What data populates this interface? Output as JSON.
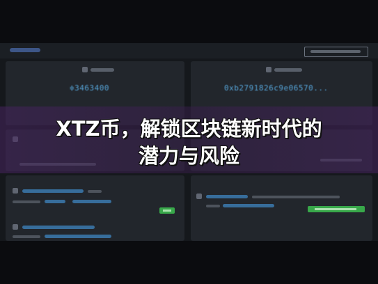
{
  "headline": {
    "line1": "XTZ币，解锁区块链新时代的",
    "line2": "潜力与风险"
  },
  "stats": {
    "left_value": "≑3463400",
    "right_value": "0xb2791826c9e06570..."
  },
  "colors": {
    "accent_blue": "#56a4d8",
    "success_green": "#38a84a",
    "banner_purple": "#46235f"
  }
}
